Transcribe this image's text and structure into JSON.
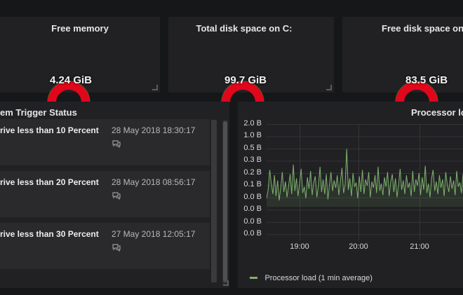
{
  "gauges": [
    {
      "title": "Free memory",
      "value": "4.24 GiB"
    },
    {
      "title": "Total disk space on C:",
      "value": "99.7 GiB"
    },
    {
      "title": "Free disk space on C",
      "value": "83.5 GiB"
    }
  ],
  "trigger_panel": {
    "title": "em Trigger Status",
    "items": [
      {
        "name": "rive less than 10 Percent",
        "time": "28 May 2018 18:30:17"
      },
      {
        "name": "rive less than 20 Percent",
        "time": "28 May 2018 08:56:17"
      },
      {
        "name": "rive less than 30 Percent",
        "time": "27 May 2018 12:05:17"
      }
    ]
  },
  "graph_panel": {
    "title": "Processor lo"
  },
  "chart_data": {
    "type": "line",
    "title": "Processor lo",
    "y_tick_labels": [
      "2.0 B",
      "1.0 B",
      "0.5 B",
      "0.3 B",
      "0.2 B",
      "0.1 B",
      "0.0 B",
      "0.0 B",
      "0.0 B",
      "0.0 B"
    ],
    "x_tick_labels": [
      "19:00",
      "20:00",
      "21:00"
    ],
    "series": [
      {
        "name": "Processor load (1 min average)",
        "color": "#7eb26d",
        "values": [
          0.08,
          0.16,
          0.35,
          0.22,
          0.12,
          0.3,
          0.1,
          0.25,
          0.06,
          0.18,
          0.33,
          0.14,
          0.24,
          0.09,
          0.2,
          0.31,
          0.12,
          0.4,
          0.15,
          0.27,
          0.1,
          0.22,
          0.36,
          0.13,
          0.19,
          0.08,
          0.28,
          0.17,
          0.34,
          0.11,
          0.23,
          0.29,
          0.09,
          0.2,
          0.38,
          0.14,
          0.26,
          0.12,
          0.31,
          0.07,
          0.21,
          0.33,
          0.15,
          0.25,
          0.18,
          0.3,
          0.11,
          0.24,
          0.37,
          0.13,
          0.21,
          0.55,
          0.16,
          0.27,
          0.1,
          0.32,
          0.19,
          0.23,
          0.08,
          0.29,
          0.14,
          0.35,
          0.12,
          0.26,
          0.2,
          0.33,
          0.09,
          0.24,
          0.18,
          0.3,
          0.13,
          0.38,
          0.15,
          0.22,
          0.11,
          0.28,
          0.19,
          0.33,
          0.1,
          0.24,
          0.31,
          0.14,
          0.27,
          0.09,
          0.21,
          0.36,
          0.16,
          0.25,
          0.12,
          0.3,
          0.18,
          0.23,
          0.1,
          0.34,
          0.14,
          0.26,
          0.2,
          0.32,
          0.11,
          0.28,
          0.16,
          0.39,
          0.13,
          0.22,
          0.09,
          0.27,
          0.35,
          0.15,
          0.24,
          0.12,
          0.3,
          0.18,
          0.26,
          0.1,
          0.33,
          0.21,
          0.14,
          0.29,
          0.17,
          0.25,
          0.11,
          0.34,
          0.19,
          0.23,
          0.13,
          0.31
        ]
      }
    ]
  }
}
